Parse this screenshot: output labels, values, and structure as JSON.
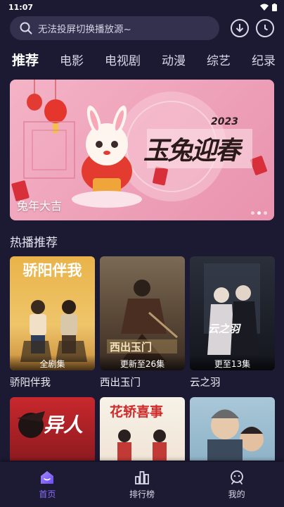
{
  "status_bar": {
    "time": "11:07"
  },
  "search": {
    "placeholder": "无法投屏切换播放源~"
  },
  "tabs": [
    {
      "label": "推荐",
      "active": true
    },
    {
      "label": "电影"
    },
    {
      "label": "电视剧"
    },
    {
      "label": "动漫"
    },
    {
      "label": "综艺"
    },
    {
      "label": "纪录"
    }
  ],
  "banner": {
    "caption": "兔年大吉",
    "art_title": "玉兔迎春",
    "art_year": "2023",
    "dots": 3,
    "active_dot": 1
  },
  "section": {
    "title": "热播推荐"
  },
  "cards": [
    {
      "title": "骄阳伴我",
      "badge": "全剧集",
      "poster_text": "骄阳伴我"
    },
    {
      "title": "西出玉门",
      "badge": "更新至26集",
      "poster_text": "西出玉门"
    },
    {
      "title": "云之羽",
      "badge": "更至13集",
      "poster_text": "云之羽"
    }
  ],
  "cards_row2": [
    {
      "poster_text": "异人"
    },
    {
      "poster_text": "花轿喜事"
    },
    {
      "poster_text": ""
    }
  ],
  "bottom_nav": [
    {
      "label": "首页",
      "icon": "home-icon",
      "active": true
    },
    {
      "label": "排行榜",
      "icon": "ranking-icon"
    },
    {
      "label": "我的",
      "icon": "profile-icon"
    }
  ],
  "colors": {
    "background": "#1c1a33",
    "accent": "#8c6cff",
    "banner": "#f4b3c6"
  }
}
